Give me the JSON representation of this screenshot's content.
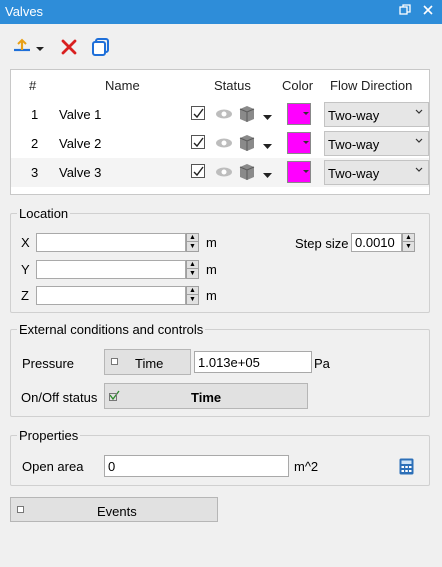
{
  "window": {
    "title": "Valves"
  },
  "toolbar": {
    "icons": [
      "add-valve-icon",
      "delete-icon",
      "copy-icon"
    ]
  },
  "table": {
    "headers": [
      "#",
      "Name",
      "Status",
      "Color",
      "Flow Direction"
    ],
    "rows": [
      {
        "num": "1",
        "name": "Valve 1",
        "visible": true,
        "color": "#ff00ff",
        "flow": "Two-way"
      },
      {
        "num": "2",
        "name": "Valve 2",
        "visible": true,
        "color": "#ff00ff",
        "flow": "Two-way"
      },
      {
        "num": "3",
        "name": "Valve 3",
        "visible": true,
        "color": "#ff00ff",
        "flow": "Two-way"
      }
    ]
  },
  "location": {
    "title": "Location",
    "x_label": "X",
    "x_value": "",
    "x_unit": "m",
    "y_label": "Y",
    "y_value": "",
    "y_unit": "m",
    "z_label": "Z",
    "z_value": "",
    "z_unit": "m",
    "step_label": "Step size",
    "step_value": "0.0010"
  },
  "conditions": {
    "title": "External conditions and controls",
    "pressure_label": "Pressure",
    "pressure_time_label": "Time",
    "pressure_value": "1.013e+05",
    "pressure_unit": "Pa",
    "onoff_label": "On/Off status",
    "onoff_time_label": "Time"
  },
  "properties": {
    "title": "Properties",
    "open_area_label": "Open area",
    "open_area_value": "0",
    "open_area_unit": "m^2"
  },
  "events": {
    "label": "Events"
  },
  "colors": {
    "titlebar": "#2e8dd9",
    "swatch": "#ff00ff",
    "delete": "#d91f1f",
    "copy": "#1e6fd9"
  }
}
